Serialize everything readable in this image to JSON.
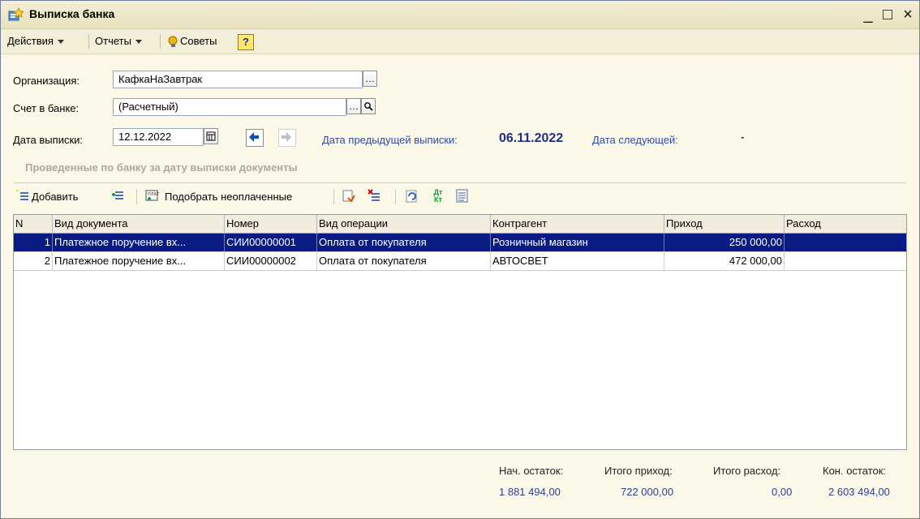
{
  "window": {
    "title": "Выписка банка",
    "controls": [
      "_",
      "□",
      "×"
    ]
  },
  "menubar": {
    "actions": "Действия",
    "reports": "Отчеты",
    "tips": "Советы",
    "help": "?"
  },
  "form": {
    "organization_label": "Организация:",
    "organization_value": "КафкаНаЗавтрак",
    "bank_account_label": "Счет в банке:",
    "bank_account_value": "(Расчетный)",
    "statement_date_label": "Дата выписки:",
    "statement_date_value": "12.12.2022",
    "previous_statement_label": "Дата предыдущей выписки:",
    "previous_statement_value": "06.11.2022",
    "next_statement_label": "Дата следующей:",
    "next_statement_value": "-",
    "section_title": "Проведенные по банку за дату выписки документы"
  },
  "toolbar": {
    "add_label": "Добавить",
    "select_unpaid_label": "Подобрать неоплаченные",
    "dt_kt_label": "Дт Кт"
  },
  "table": {
    "headers": [
      "N",
      "Вид документа",
      "Номер",
      "Вид операции",
      "Контрагент",
      "Приход",
      "Расход"
    ],
    "rows": [
      {
        "n": "1",
        "doc_type": "Платежное поручение вх...",
        "number": "СИИ00000001",
        "operation": "Оплата от покупателя",
        "counterparty": "Розничный магазин",
        "income": "250 000,00",
        "expense": ""
      },
      {
        "n": "2",
        "doc_type": "Платежное поручение вх...",
        "number": "СИИ00000002",
        "operation": "Оплата от покупателя",
        "counterparty": "АВТОСВЕТ",
        "income": "472 000,00",
        "expense": ""
      }
    ]
  },
  "summary": {
    "opening_label": "Нач. остаток:",
    "opening_value": "1 881 494,00",
    "income_label": "Итого приход:",
    "income_value": "722 000,00",
    "expense_label": "Итого расход:",
    "expense_value": "0,00",
    "closing_label": "Кон. остаток:",
    "closing_value": "2 603 494,00"
  }
}
